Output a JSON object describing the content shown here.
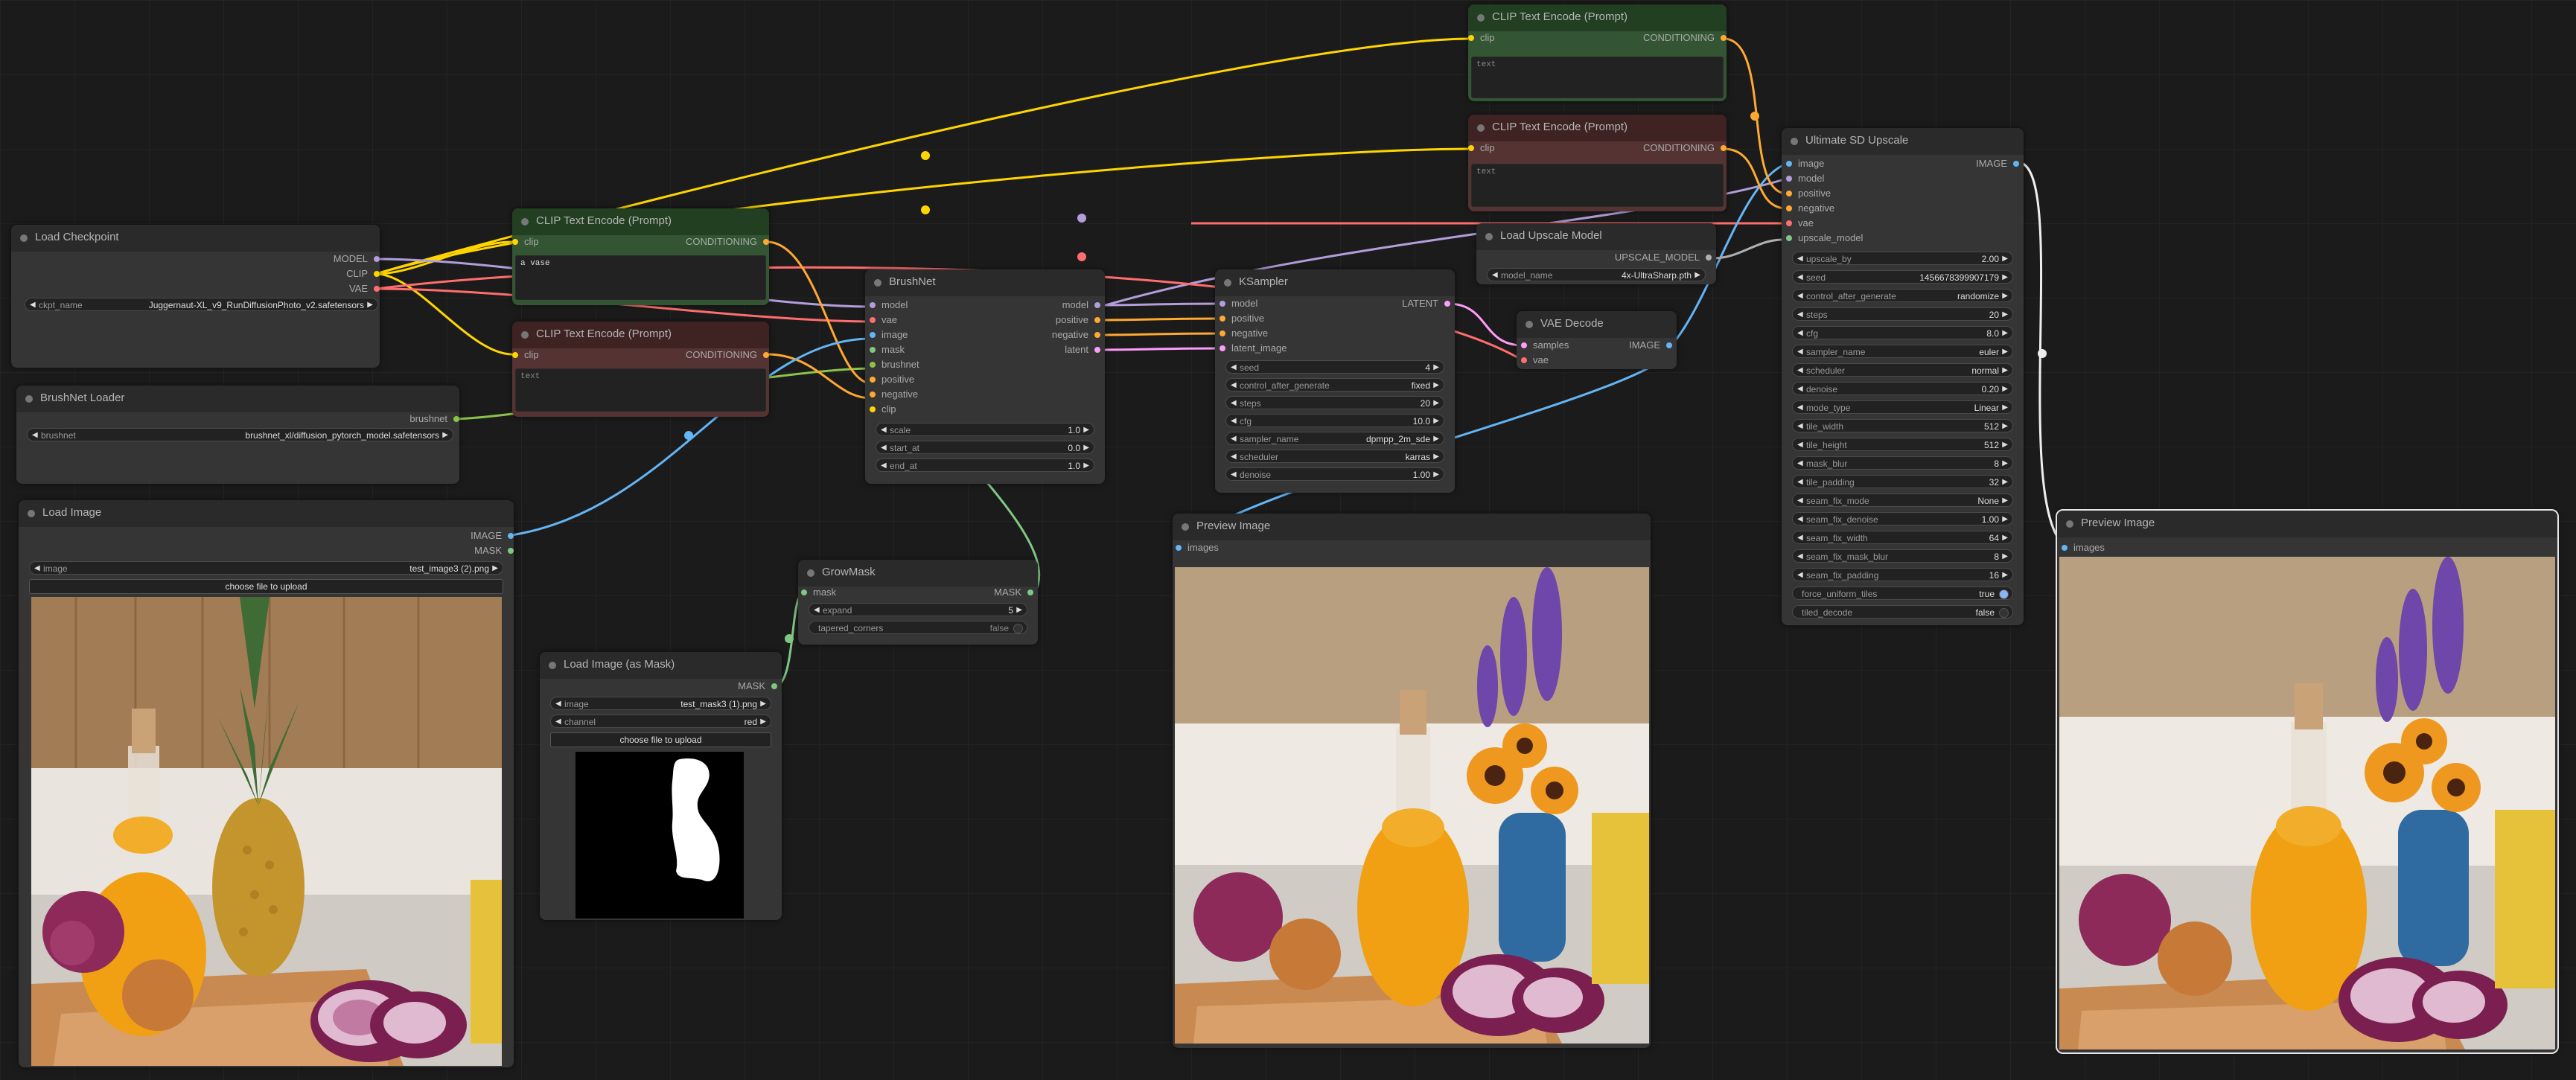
{
  "colors": {
    "MODEL": "#b39ddb",
    "CLIP": "#ffd500",
    "VAE": "#ff6e6e",
    "CONDITIONING": "#ffa931",
    "IMAGE": "#64b5f6",
    "MASK": "#81c784",
    "LATENT": "#ff9cf9",
    "BRUSHNET": "#8bc34a",
    "UPSCALE_MODEL": "#b0b0b0",
    "wire_white": "#eeeeee"
  },
  "nodes": {
    "load_checkpoint": {
      "title": "Load Checkpoint",
      "outputs": [
        "MODEL",
        "CLIP",
        "VAE"
      ],
      "widgets": [
        {
          "label": "ckpt_name",
          "value": "Juggernaut-XL_v9_RunDiffusionPhoto_v2.safetensors"
        }
      ]
    },
    "brushnet_loader": {
      "title": "BrushNet Loader",
      "outputs": [
        "brushnet"
      ],
      "widgets": [
        {
          "label": "brushnet",
          "value": "brushnet_xl/diffusion_pytorch_model.safetensors"
        }
      ]
    },
    "load_image": {
      "title": "Load Image",
      "outputs": [
        "IMAGE",
        "MASK"
      ],
      "widgets": [
        {
          "label": "image",
          "value": "test_image3 (2).png"
        }
      ],
      "button": "choose file to upload"
    },
    "clip_pos": {
      "title": "CLIP Text Encode (Prompt)",
      "inputs": [
        "clip"
      ],
      "outputs": [
        "CONDITIONING"
      ],
      "text": "a vase"
    },
    "clip_neg": {
      "title": "CLIP Text Encode (Prompt)",
      "inputs": [
        "clip"
      ],
      "outputs": [
        "CONDITIONING"
      ],
      "placeholder": "text"
    },
    "brushnet": {
      "title": "BrushNet",
      "inputs": [
        "model",
        "vae",
        "image",
        "mask",
        "brushnet",
        "positive",
        "negative",
        "clip"
      ],
      "outputs": [
        "model",
        "positive",
        "negative",
        "latent"
      ],
      "widgets": [
        {
          "label": "scale",
          "value": "1.0"
        },
        {
          "label": "start_at",
          "value": "0.0"
        },
        {
          "label": "end_at",
          "value": "1.0"
        }
      ]
    },
    "load_image_mask": {
      "title": "Load Image (as Mask)",
      "outputs": [
        "MASK"
      ],
      "widgets": [
        {
          "label": "image",
          "value": "test_mask3 (1).png"
        },
        {
          "label": "channel",
          "value": "red"
        }
      ],
      "button": "choose file to upload"
    },
    "growmask": {
      "title": "GrowMask",
      "inputs": [
        "mask"
      ],
      "outputs": [
        "MASK"
      ],
      "widgets": [
        {
          "label": "expand",
          "value": "5"
        },
        {
          "label": "tapered_corners",
          "value": "false"
        }
      ]
    },
    "ksampler": {
      "title": "KSampler",
      "inputs": [
        "model",
        "positive",
        "negative",
        "latent_image"
      ],
      "outputs": [
        "LATENT"
      ],
      "widgets": [
        {
          "label": "seed",
          "value": "4"
        },
        {
          "label": "control_after_generate",
          "value": "fixed"
        },
        {
          "label": "steps",
          "value": "20"
        },
        {
          "label": "cfg",
          "value": "10.0"
        },
        {
          "label": "sampler_name",
          "value": "dpmpp_2m_sde"
        },
        {
          "label": "scheduler",
          "value": "karras"
        },
        {
          "label": "denoise",
          "value": "1.00"
        }
      ]
    },
    "vae_decode": {
      "title": "VAE Decode",
      "inputs": [
        "samples",
        "vae"
      ],
      "outputs": [
        "IMAGE"
      ]
    },
    "load_upscale": {
      "title": "Load Upscale Model",
      "outputs": [
        "UPSCALE_MODEL"
      ],
      "widgets": [
        {
          "label": "model_name",
          "value": "4x-UltraSharp.pth"
        }
      ]
    },
    "preview1": {
      "title": "Preview Image",
      "inputs": [
        "images"
      ]
    },
    "clip_top1": {
      "title": "CLIP Text Encode (Prompt)",
      "inputs": [
        "clip"
      ],
      "outputs": [
        "CONDITIONING"
      ],
      "placeholder": "text"
    },
    "clip_top2": {
      "title": "CLIP Text Encode (Prompt)",
      "inputs": [
        "clip"
      ],
      "outputs": [
        "CONDITIONING"
      ],
      "placeholder": "text"
    },
    "upscale": {
      "title": "Ultimate SD Upscale",
      "inputs": [
        "image",
        "model",
        "positive",
        "negative",
        "vae",
        "upscale_model"
      ],
      "outputs": [
        "IMAGE"
      ],
      "widgets": [
        {
          "label": "upscale_by",
          "value": "2.00"
        },
        {
          "label": "seed",
          "value": "1456678399907179"
        },
        {
          "label": "control_after_generate",
          "value": "randomize"
        },
        {
          "label": "steps",
          "value": "20"
        },
        {
          "label": "cfg",
          "value": "8.0"
        },
        {
          "label": "sampler_name",
          "value": "euler"
        },
        {
          "label": "scheduler",
          "value": "normal"
        },
        {
          "label": "denoise",
          "value": "0.20"
        },
        {
          "label": "mode_type",
          "value": "Linear"
        },
        {
          "label": "tile_width",
          "value": "512"
        },
        {
          "label": "tile_height",
          "value": "512"
        },
        {
          "label": "mask_blur",
          "value": "8"
        },
        {
          "label": "tile_padding",
          "value": "32"
        },
        {
          "label": "seam_fix_mode",
          "value": "None"
        },
        {
          "label": "seam_fix_denoise",
          "value": "1.00"
        },
        {
          "label": "seam_fix_width",
          "value": "64"
        },
        {
          "label": "seam_fix_mask_blur",
          "value": "8"
        },
        {
          "label": "seam_fix_padding",
          "value": "16"
        },
        {
          "label": "force_uniform_tiles",
          "value": "true"
        },
        {
          "label": "tiled_decode",
          "value": "false"
        }
      ]
    },
    "preview2": {
      "title": "Preview Image",
      "inputs": [
        "images"
      ]
    }
  }
}
